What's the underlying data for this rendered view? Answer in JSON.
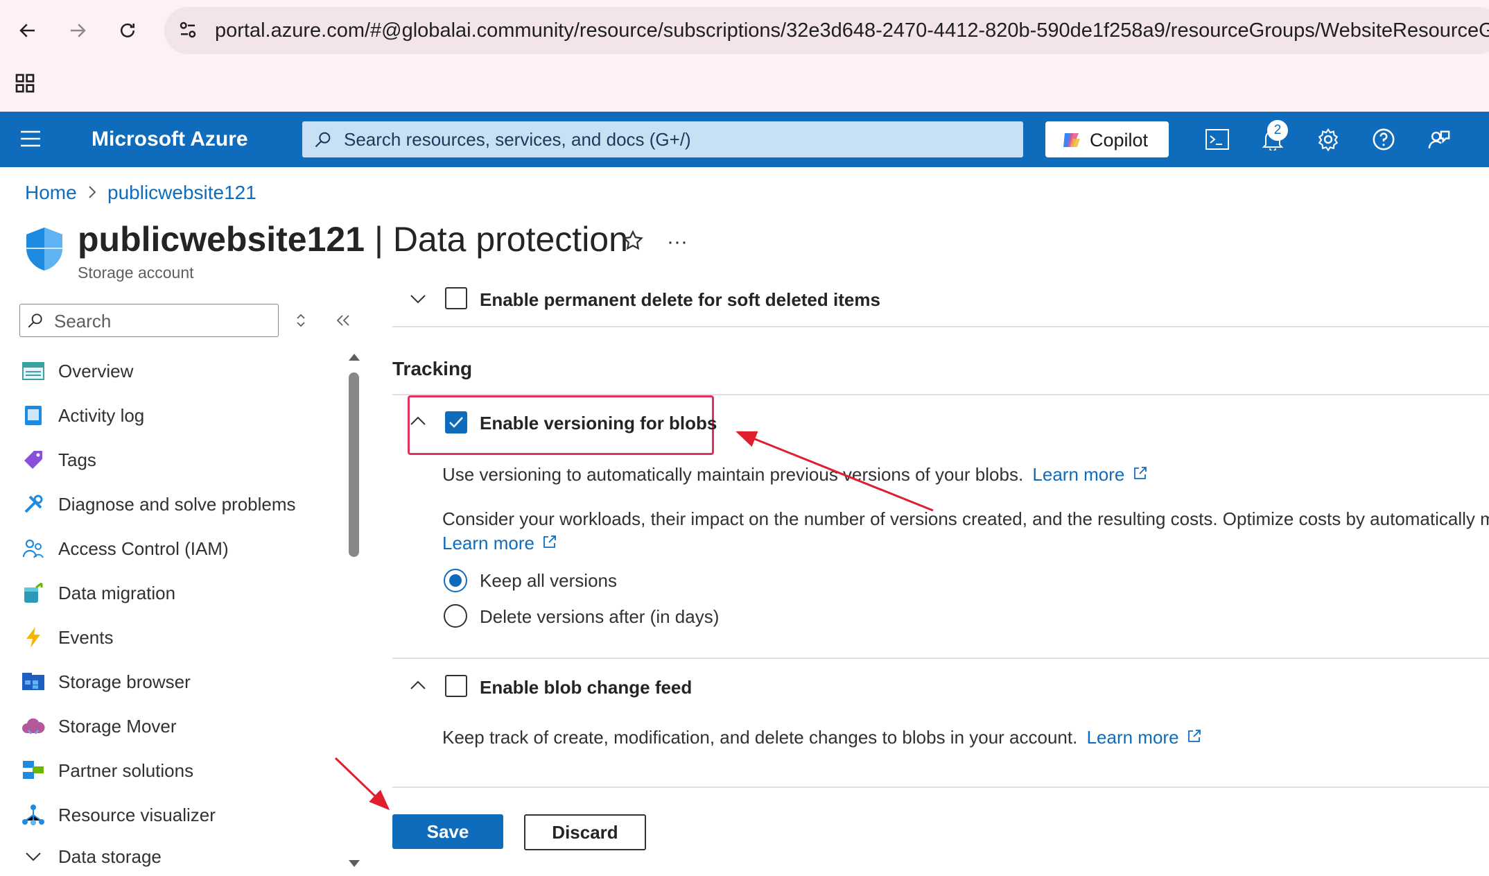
{
  "browser": {
    "url": "portal.azure.com/#@globalai.community/resource/subscriptions/32e3d648-2470-4412-820b-590de1f258a9/resourceGroups/WebsiteResourceGroup/"
  },
  "header": {
    "brand": "Microsoft Azure",
    "search_placeholder": "Search resources, services, and docs (G+/)",
    "copilot_label": "Copilot",
    "notification_count": "2"
  },
  "breadcrumb": {
    "home": "Home",
    "resource": "publicwebsite121"
  },
  "page": {
    "resource_name": "publicwebsite121",
    "separator": " | ",
    "blade_name": "Data protection",
    "subtitle": "Storage account"
  },
  "sidebar": {
    "search_placeholder": "Search",
    "items": [
      {
        "label": "Overview",
        "icon": "overview-icon"
      },
      {
        "label": "Activity log",
        "icon": "activity-log-icon"
      },
      {
        "label": "Tags",
        "icon": "tag-icon"
      },
      {
        "label": "Diagnose and solve problems",
        "icon": "wrench-icon"
      },
      {
        "label": "Access Control (IAM)",
        "icon": "people-icon"
      },
      {
        "label": "Data migration",
        "icon": "data-migration-icon"
      },
      {
        "label": "Events",
        "icon": "lightning-icon"
      },
      {
        "label": "Storage browser",
        "icon": "storage-browser-icon"
      },
      {
        "label": "Storage Mover",
        "icon": "cloud-icon"
      },
      {
        "label": "Partner solutions",
        "icon": "partner-icon"
      },
      {
        "label": "Resource visualizer",
        "icon": "hierarchy-icon"
      },
      {
        "label": "Data storage",
        "icon": "chevron-down-icon"
      }
    ]
  },
  "content": {
    "permanent_delete_label": "Enable permanent delete for soft deleted items",
    "tracking_heading": "Tracking",
    "versioning": {
      "label": "Enable versioning for blobs",
      "checked": true,
      "description": "Use versioning to automatically maintain previous versions of your blobs.",
      "learn_more": "Learn more",
      "consider_text": "Consider your workloads, their impact on the number of versions created, and the resulting costs. Optimize costs by automatically managing the data lifecycle.",
      "learn_more_2": "Learn more",
      "options": [
        {
          "label": "Keep all versions",
          "selected": true
        },
        {
          "label": "Delete versions after (in days)",
          "selected": false
        }
      ]
    },
    "change_feed": {
      "label": "Enable blob change feed",
      "checked": false,
      "description": "Keep track of create, modification, and delete changes to blobs in your account.",
      "learn_more": "Learn more"
    }
  },
  "actions": {
    "save": "Save",
    "discard": "Discard"
  },
  "colors": {
    "azure_blue": "#0f6cbd",
    "annotation_red": "#e0305e"
  }
}
